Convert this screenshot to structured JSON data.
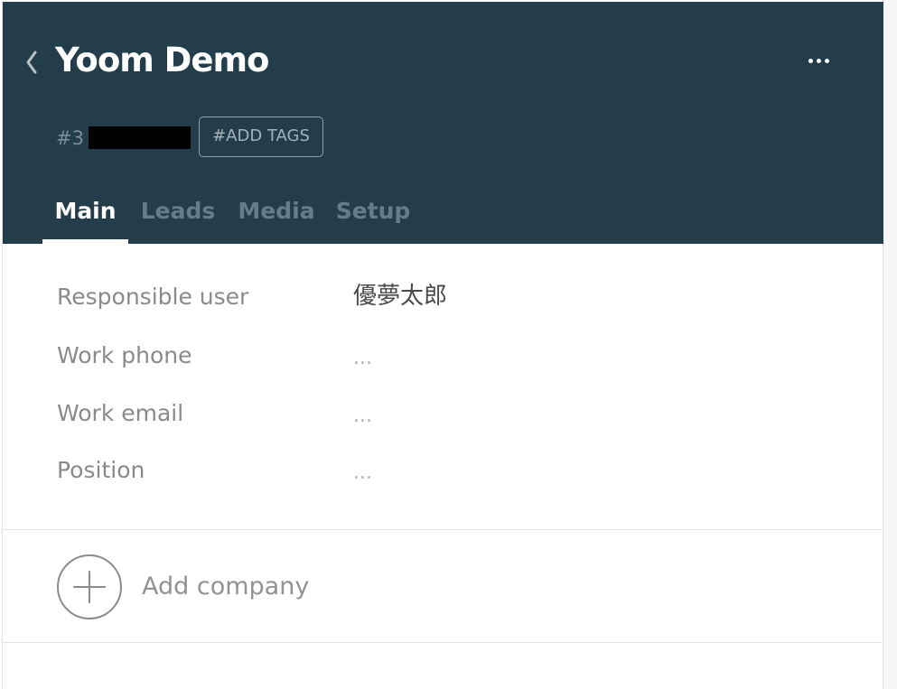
{
  "header": {
    "title": "Yoom Demo",
    "id_prefix": "#3",
    "add_tags_label": "#ADD TAGS",
    "back_icon": "chevron-left-icon",
    "more_icon": "more-horizontal-icon",
    "background_color": "#233d4a"
  },
  "tabs": [
    {
      "label": "Main",
      "active": true
    },
    {
      "label": "Leads",
      "active": false
    },
    {
      "label": "Media",
      "active": false
    },
    {
      "label": "Setup",
      "active": false
    }
  ],
  "fields": [
    {
      "label": "Responsible user",
      "value": "優夢太郎"
    },
    {
      "label": "Work phone",
      "value": "..."
    },
    {
      "label": "Work email",
      "value": "..."
    },
    {
      "label": "Position",
      "value": "..."
    }
  ],
  "company": {
    "add_label": "Add company",
    "icon": "plus-circle-icon"
  }
}
